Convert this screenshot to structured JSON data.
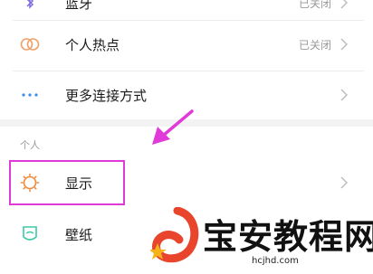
{
  "rows": {
    "top_partial": {
      "label": "蓝牙",
      "status": "已关闭"
    },
    "hotspot": {
      "label": "个人热点",
      "status": "已关闭"
    },
    "more_connection": {
      "label": "更多连接方式"
    },
    "display": {
      "label": "显示"
    },
    "wallpaper": {
      "label": "壁纸"
    }
  },
  "section": {
    "personal": "个人"
  },
  "icons": {
    "top_partial": "bluetooth-icon",
    "hotspot": "hotspot-icon",
    "more_connection": "more-dots-icon",
    "display": "display-brightness-icon",
    "wallpaper": "wallpaper-icon",
    "chevron": "chevron-right-icon",
    "annotation_arrow": "arrow-icon"
  },
  "colors": {
    "hotspot_icon": "#f0a06a",
    "more_icon": "#3b8cf0",
    "display_icon": "#f08a3c",
    "wallpaper_icon": "#3ec9a7",
    "highlight": "#e03ad9",
    "watermark_logo": "#e8452c"
  },
  "watermark": {
    "text": "宝安教程网",
    "url": "hcjhd.com"
  }
}
